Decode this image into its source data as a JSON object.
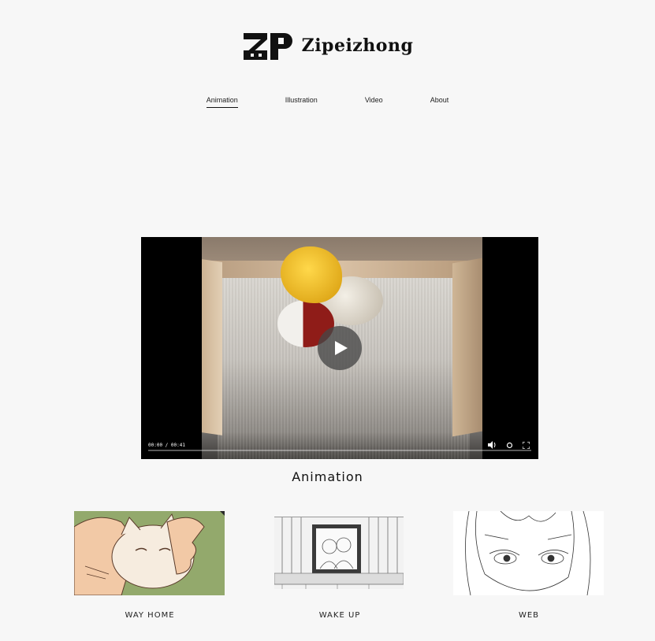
{
  "header": {
    "site_name": "Zipeizhong",
    "logo_letters": "ZP"
  },
  "nav": {
    "items": [
      {
        "label": "Animation",
        "active": true
      },
      {
        "label": "Illustration",
        "active": false
      },
      {
        "label": "Video",
        "active": false
      },
      {
        "label": "About",
        "active": false
      }
    ]
  },
  "video": {
    "time": "00:00 / 00:41",
    "progress": 0,
    "icons": [
      "play-icon",
      "volume-icon",
      "settings-icon",
      "fullscreen-icon"
    ]
  },
  "section": {
    "title": "Animation"
  },
  "projects": [
    {
      "label": "WAY HOME",
      "thumbnail": "cat-hand-illustration"
    },
    {
      "label": "WAKE UP",
      "thumbnail": "framed-photo-sketch"
    },
    {
      "label": "WEB",
      "thumbnail": "face-line-sketch"
    }
  ],
  "colors": {
    "background": "#f7f7f7",
    "text": "#111111",
    "video_bg": "#000000",
    "thumb_green": "#8fa56a"
  }
}
